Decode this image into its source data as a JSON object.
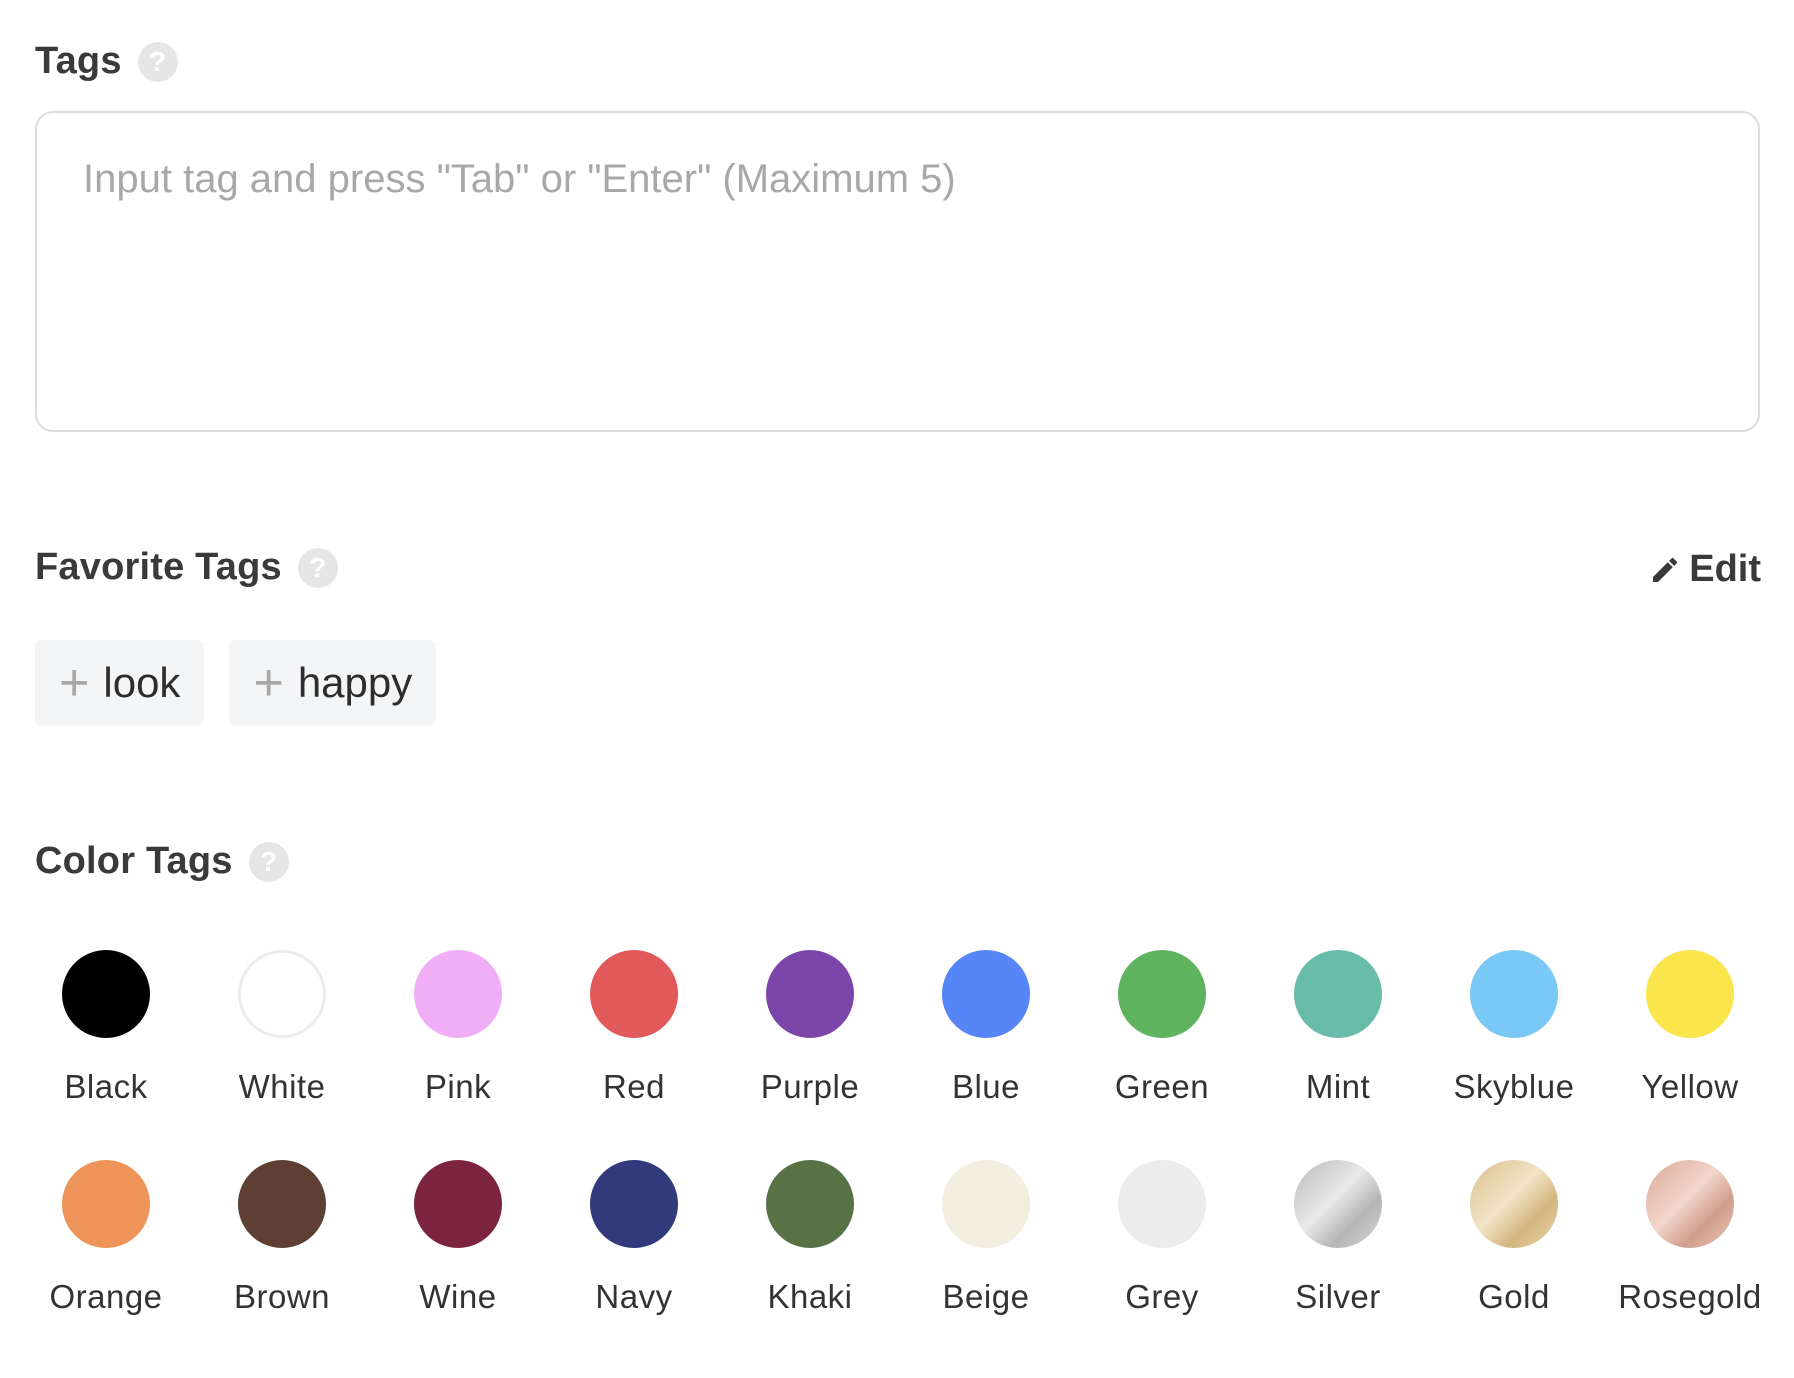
{
  "tags": {
    "title": "Tags",
    "help": "?",
    "placeholder": "Input tag and press \"Tab\" or \"Enter\" (Maximum 5)"
  },
  "favorite_tags": {
    "title": "Favorite Tags",
    "help": "?",
    "edit_label": "Edit",
    "items": [
      "look",
      "happy"
    ]
  },
  "color_tags": {
    "title": "Color Tags",
    "help": "?",
    "colors": [
      {
        "label": "Black",
        "color": "#000000"
      },
      {
        "label": "White",
        "color": "#ffffff"
      },
      {
        "label": "Pink",
        "color": "#f0aef6"
      },
      {
        "label": "Red",
        "color": "#e2595b"
      },
      {
        "label": "Purple",
        "color": "#7c45a9"
      },
      {
        "label": "Blue",
        "color": "#5585f7"
      },
      {
        "label": "Green",
        "color": "#5fb35e"
      },
      {
        "label": "Mint",
        "color": "#69bcaa"
      },
      {
        "label": "Skyblue",
        "color": "#7ac8f6"
      },
      {
        "label": "Yellow",
        "color": "#fae54d"
      },
      {
        "label": "Orange",
        "color": "#ef9459"
      },
      {
        "label": "Brown",
        "color": "#5e3f33"
      },
      {
        "label": "Wine",
        "color": "#7c2340"
      },
      {
        "label": "Navy",
        "color": "#333a7c"
      },
      {
        "label": "Khaki",
        "color": "#587246"
      },
      {
        "label": "Beige",
        "color": "#f2eee0"
      },
      {
        "label": "Grey",
        "color": "#ececec"
      },
      {
        "label": "Silver",
        "color": "#c8c8c8"
      },
      {
        "label": "Gold",
        "color": "#e4cfa6"
      },
      {
        "label": "Rosegold",
        "color": "#e2b9a9"
      }
    ]
  }
}
